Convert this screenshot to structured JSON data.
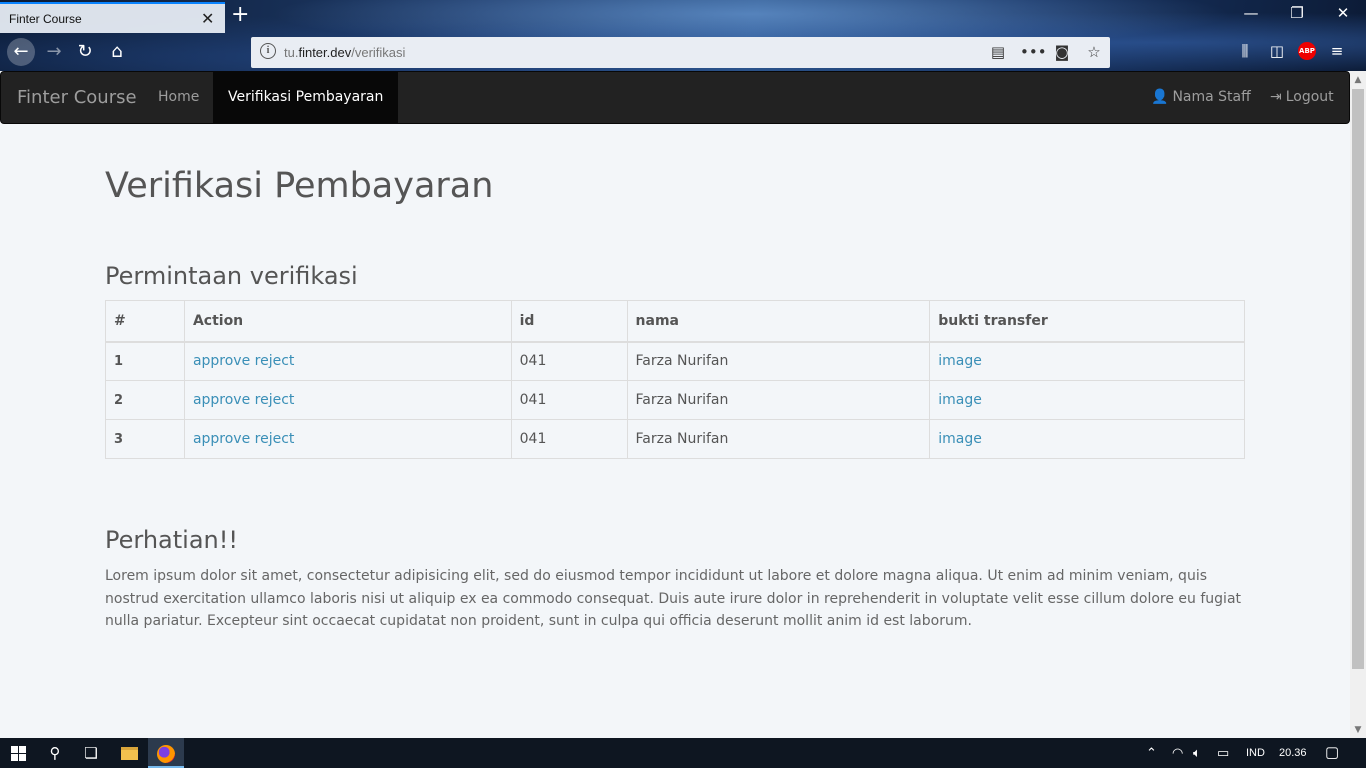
{
  "browser": {
    "tab_title": "Finter Course",
    "url_prefix": "tu.",
    "url_domain": "finter.dev",
    "url_path": "/verifikasi"
  },
  "nav": {
    "brand": "Finter Course",
    "home": "Home",
    "verifikasi": "Verifikasi Pembayaran",
    "staff": "Nama Staff",
    "logout": "Logout"
  },
  "page": {
    "title": "Verifikasi Pembayaran",
    "subtitle": "Permintaan verifikasi",
    "table": {
      "headers": [
        "#",
        "Action",
        "id",
        "nama",
        "bukti transfer"
      ],
      "rows": [
        {
          "num": "1",
          "approve": "approve",
          "reject": "reject",
          "id": "041",
          "nama": "Farza Nurifan",
          "bukti": "image"
        },
        {
          "num": "2",
          "approve": "approve",
          "reject": "reject",
          "id": "041",
          "nama": "Farza Nurifan",
          "bukti": "image"
        },
        {
          "num": "3",
          "approve": "approve",
          "reject": "reject",
          "id": "041",
          "nama": "Farza Nurifan",
          "bukti": "image"
        }
      ]
    },
    "warning_title": "Perhatian!!",
    "warning_text": "Lorem ipsum dolor sit amet, consectetur adipisicing elit, sed do eiusmod tempor incididunt ut labore et dolore magna aliqua. Ut enim ad minim veniam, quis nostrud exercitation ullamco laboris nisi ut aliquip ex ea commodo consequat. Duis aute irure dolor in reprehenderit in voluptate velit esse cillum dolore eu fugiat nulla pariatur. Excepteur sint occaecat cupidatat non proident, sunt in culpa qui officia deserunt mollit anim id est laborum."
  },
  "taskbar": {
    "language": "IND",
    "time": "20.36"
  },
  "colors": {
    "link": "#3a8fb7",
    "navbar_bg": "#222222",
    "page_bg": "#f3f6f9"
  }
}
